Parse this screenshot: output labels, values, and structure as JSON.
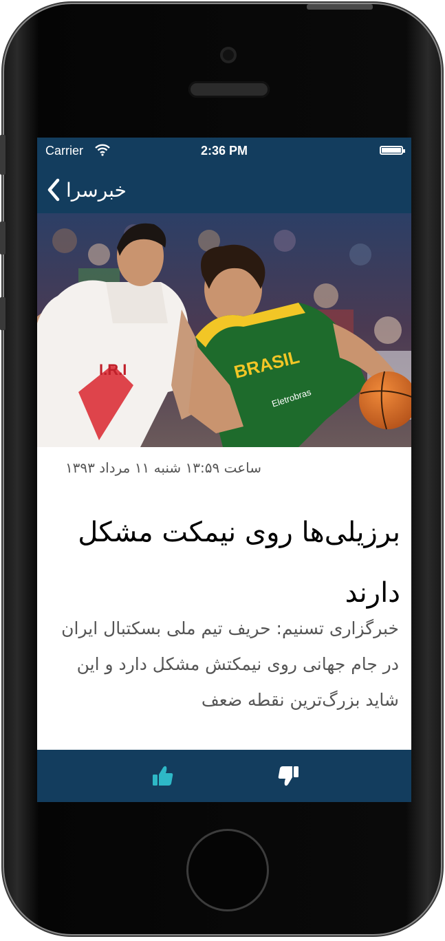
{
  "status_bar": {
    "carrier": "Carrier",
    "time": "2:36 PM",
    "wifi_icon": "wifi-icon",
    "battery_icon": "battery-icon"
  },
  "nav": {
    "back_label": "خبرسرا",
    "back_icon": "chevron-left-icon"
  },
  "hero_image": {
    "description_icon": "basketball-photo",
    "jersey_left": "I.R.I",
    "jersey_right": "BRASIL",
    "sponsor": "Eletrobras"
  },
  "article": {
    "date": "ساعت ۱۳:۵۹ شنبه ۱۱ مرداد ۱۳۹۳",
    "title": "برزیلی‌ها روی نیمکت مشکل دارند",
    "summary": "خبرگزاری تسنیم: حریف تیم ملی بسکتبال ایران در جام جهانی روی نیمکتش مشکل دارد و این شاید بزرگ‌ترین نقطه ضعف"
  },
  "toolbar": {
    "like_icon": "thumbs-up-icon",
    "dislike_icon": "thumbs-down-icon"
  },
  "colors": {
    "bar": "#133d5e",
    "accent": "#2eb8c7"
  }
}
